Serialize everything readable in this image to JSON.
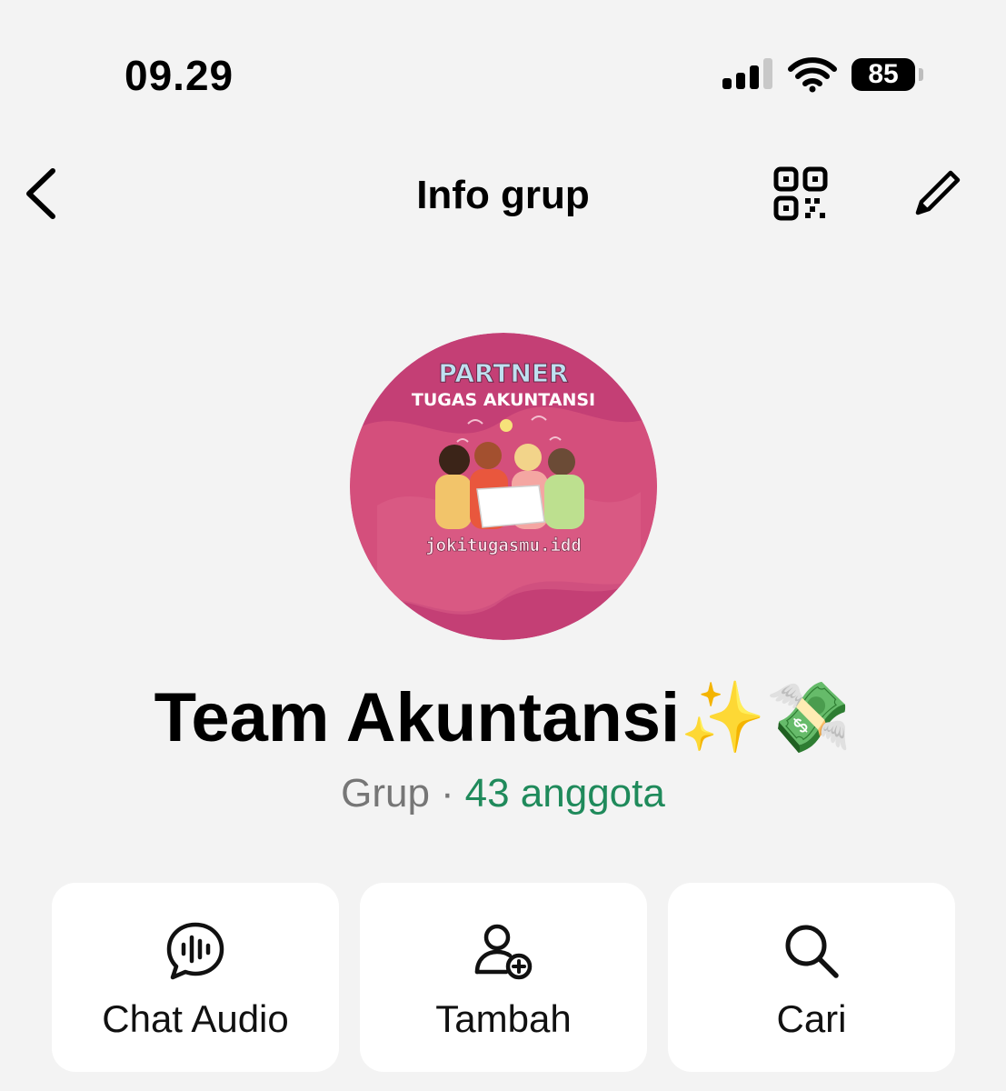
{
  "status_bar": {
    "time": "09.29",
    "battery_level": "85",
    "icons": [
      "cellular-signal-icon",
      "wifi-icon",
      "battery-icon"
    ]
  },
  "header": {
    "title": "Info grup",
    "icons": [
      "back-chevron-icon",
      "qr-code-icon",
      "edit-pencil-icon"
    ]
  },
  "avatar": {
    "title_line1": "PARTNER",
    "title_line2": "TUGAS AKUNTANSI",
    "handle": "jokitugasmu.idd"
  },
  "group": {
    "name": "Team Akuntansi✨💸",
    "kind": "Grup",
    "separator": "·",
    "members": "43 anggota"
  },
  "actions": [
    {
      "label": "Chat Audio",
      "icon": "audio-chat-icon"
    },
    {
      "label": "Tambah",
      "icon": "add-person-icon"
    },
    {
      "label": "Cari",
      "icon": "search-icon"
    }
  ],
  "colors": {
    "background": "#f3f3f3",
    "card": "#ffffff",
    "accent_green": "#1f8a5b",
    "muted_gray": "#767676",
    "avatar_pink": "#c43f75"
  }
}
